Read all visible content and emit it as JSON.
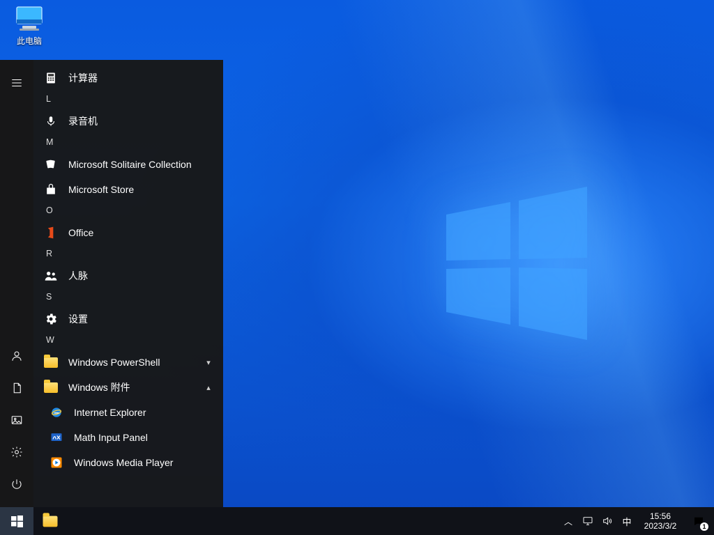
{
  "desktop": {
    "icons": [
      {
        "name": "此电脑"
      }
    ]
  },
  "start_menu": {
    "rail": [
      "menu",
      "user",
      "documents",
      "pictures",
      "settings",
      "power"
    ],
    "list": [
      {
        "type": "app",
        "key": "calculator",
        "label": "计算器"
      },
      {
        "type": "alpha",
        "label": "L"
      },
      {
        "type": "app",
        "key": "voice_recorder",
        "label": "录音机"
      },
      {
        "type": "alpha",
        "label": "M"
      },
      {
        "type": "app",
        "key": "solitaire",
        "label": "Microsoft Solitaire Collection"
      },
      {
        "type": "app",
        "key": "store",
        "label": "Microsoft Store"
      },
      {
        "type": "alpha",
        "label": "O"
      },
      {
        "type": "app",
        "key": "office",
        "label": "Office"
      },
      {
        "type": "alpha",
        "label": "R"
      },
      {
        "type": "app",
        "key": "people",
        "label": "人脉"
      },
      {
        "type": "alpha",
        "label": "S"
      },
      {
        "type": "app",
        "key": "settings",
        "label": "设置"
      },
      {
        "type": "alpha",
        "label": "W"
      },
      {
        "type": "app",
        "key": "powershell_folder",
        "label": "Windows PowerShell",
        "chevron": "down"
      },
      {
        "type": "app",
        "key": "accessories_folder",
        "label": "Windows 附件",
        "chevron": "up"
      },
      {
        "type": "sub",
        "key": "ie",
        "label": "Internet Explorer"
      },
      {
        "type": "sub",
        "key": "math_input",
        "label": "Math Input Panel"
      },
      {
        "type": "sub",
        "key": "wmp",
        "label": "Windows Media Player"
      }
    ]
  },
  "taskbar": {
    "buttons": [
      "start",
      "explorer"
    ],
    "tray": [
      "overflow",
      "display_project",
      "volume",
      "ime"
    ],
    "ime_text": "中",
    "clock": {
      "time": "15:56",
      "date": "2023/3/2"
    },
    "notification_count": "1"
  }
}
